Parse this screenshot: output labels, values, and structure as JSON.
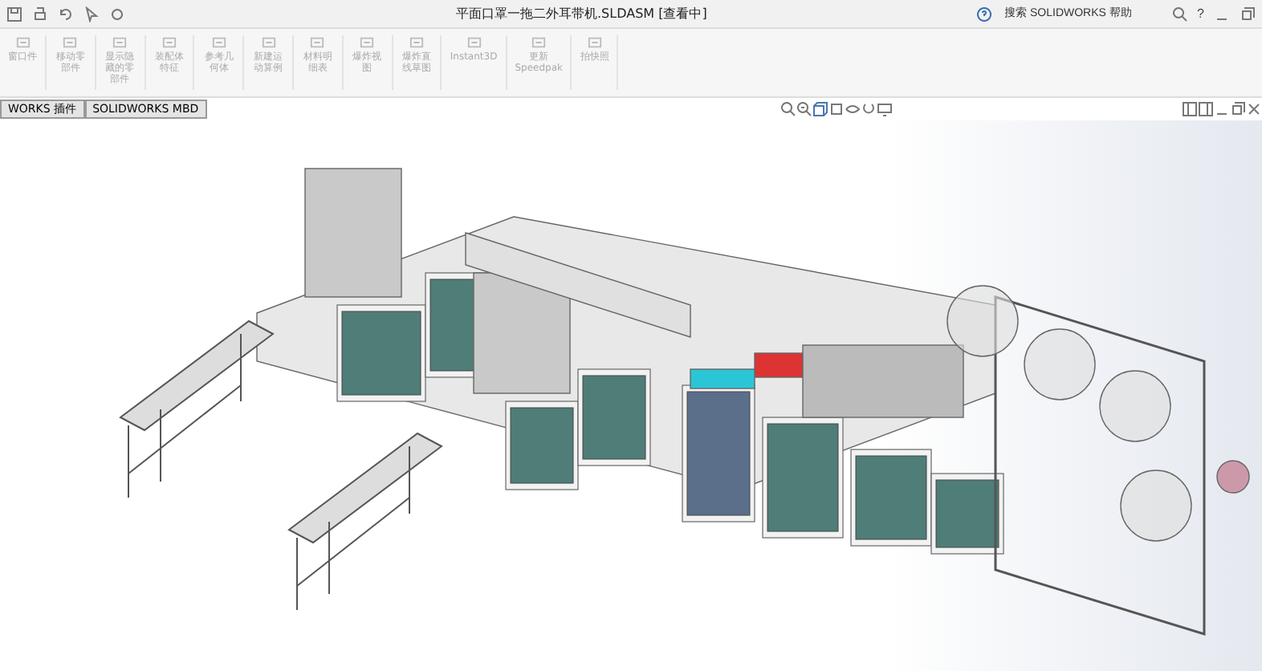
{
  "window": {
    "title": "平面口罩一拖二外耳带机.SLDASM [查看中]",
    "search": {
      "placeholder": "搜索 SOLIDWORKS 帮助"
    },
    "help": "?"
  },
  "ribbon": [
    {
      "label": "窗口件",
      "disabled": true
    },
    {
      "label": "移动零部件",
      "disabled": true
    },
    {
      "label": "显示隐藏的零部件",
      "disabled": true
    },
    {
      "label": "装配体特征",
      "disabled": true
    },
    {
      "label": "参考几何体",
      "disabled": true
    },
    {
      "label": "新建运动算例",
      "disabled": true
    },
    {
      "label": "材料明细表",
      "disabled": true
    },
    {
      "label": "爆炸视图",
      "disabled": true
    },
    {
      "label": "爆炸直线草图",
      "disabled": true
    },
    {
      "label": "Instant3D",
      "disabled": true
    },
    {
      "label": "更新\nSpeedpak",
      "disabled": true
    },
    {
      "label": "拍快照",
      "disabled": true
    }
  ],
  "tabs": [
    {
      "label": "WORKS 插件",
      "selected": false
    },
    {
      "label": "SOLIDWORKS MBD",
      "selected": false
    }
  ]
}
